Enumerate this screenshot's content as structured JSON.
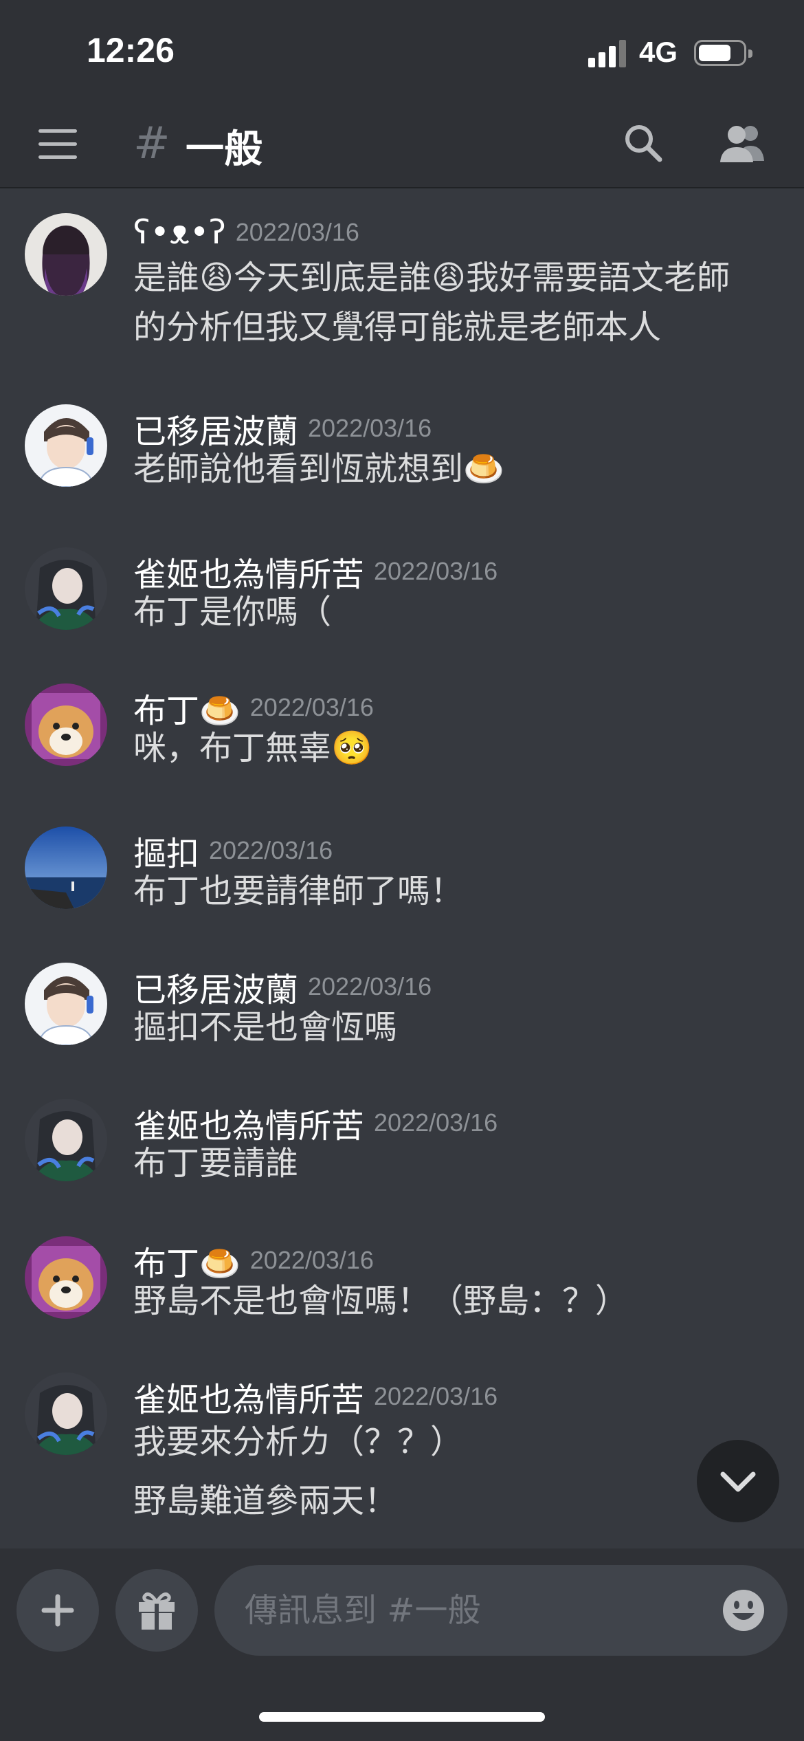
{
  "status_bar": {
    "time": "12:26",
    "network": "4G"
  },
  "header": {
    "channel_name": "一般"
  },
  "messages": [
    {
      "username": "ʕ•ᴥ•ʔ",
      "timestamp": "2022/03/16",
      "lines": [
        "是誰😩今天到底是誰😩我好需要語文老師",
        "的分析但我又覺得可能就是老師本人"
      ],
      "avatar": "purple-hair-avatar"
    },
    {
      "username": "已移居波蘭",
      "timestamp": "2022/03/16",
      "lines": [
        "老師說他看到恆就想到🍮"
      ],
      "avatar": "anime-boy-avatar"
    },
    {
      "username": "雀姬也為情所苦",
      "timestamp": "2022/03/16",
      "lines": [
        "布丁是你嗎（"
      ],
      "avatar": "anime-girl-avatar"
    },
    {
      "username": "布丁🍮",
      "timestamp": "2022/03/16",
      "lines": [
        "咪，布丁無辜🥺"
      ],
      "avatar": "shiba-avatar"
    },
    {
      "username": "摳扣",
      "timestamp": "2022/03/16",
      "lines": [
        "布丁也要請律師了嗎！"
      ],
      "avatar": "sky-sea-avatar"
    },
    {
      "username": "已移居波蘭",
      "timestamp": "2022/03/16",
      "lines": [
        "摳扣不是也會恆嗎"
      ],
      "avatar": "anime-boy-avatar"
    },
    {
      "username": "雀姬也為情所苦",
      "timestamp": "2022/03/16",
      "lines": [
        "布丁要請誰"
      ],
      "avatar": "anime-girl-avatar"
    },
    {
      "username": "布丁🍮",
      "timestamp": "2022/03/16",
      "lines": [
        "野島不是也會恆嗎！（野島：？）"
      ],
      "avatar": "shiba-avatar"
    },
    {
      "username": "雀姬也為情所苦",
      "timestamp": "2022/03/16",
      "lines": [
        "我要來分析ㄌ（？？）",
        "野島難道參兩天！"
      ],
      "avatar": "anime-girl-avatar"
    }
  ],
  "input": {
    "placeholder": "傳訊息到 #一般"
  },
  "icons": {
    "menu": "hamburger-menu-icon",
    "search": "search-icon",
    "members": "members-icon",
    "add": "plus-icon",
    "gift": "gift-icon",
    "emoji": "smiley-icon",
    "scroll": "chevron-down-icon"
  },
  "colors": {
    "background": "#36393f",
    "header": "#2f3136",
    "input": "#40444b"
  }
}
